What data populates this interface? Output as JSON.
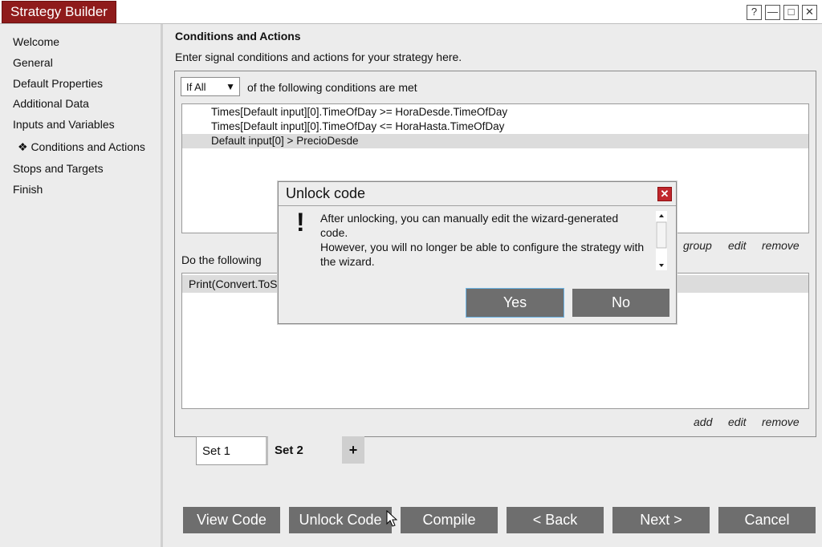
{
  "window": {
    "title": "Strategy Builder",
    "controls": {
      "help": "?",
      "minimize": "—",
      "maximize": "□",
      "close": "✕"
    }
  },
  "sidebar": {
    "items": [
      {
        "label": "Welcome"
      },
      {
        "label": "General"
      },
      {
        "label": "Default Properties"
      },
      {
        "label": "Additional Data"
      },
      {
        "label": "Inputs and Variables"
      },
      {
        "label": "❖ Conditions and Actions"
      },
      {
        "label": "Stops and Targets"
      },
      {
        "label": "Finish"
      }
    ],
    "active_index": 5
  },
  "main": {
    "heading": "Conditions and Actions",
    "subheading": "Enter signal conditions and actions for your strategy here.",
    "condition_mode": "If All",
    "condition_suffix": "of the following conditions are met",
    "conditions": [
      "Times[Default input][0].TimeOfDay >= HoraDesde.TimeOfDay",
      "Times[Default input][0].TimeOfDay <= HoraHasta.TimeOfDay",
      "Default input[0] > PrecioDesde"
    ],
    "condition_links": {
      "group": "group",
      "edit": "edit",
      "remove": "remove"
    },
    "do_label": "Do the following",
    "actions": [
      "Print(Convert.ToS"
    ],
    "action_links": {
      "add": "add",
      "edit": "edit",
      "remove": "remove"
    },
    "sets": [
      {
        "label": "Set 1"
      },
      {
        "label": "Set 2"
      }
    ],
    "add_set": "+"
  },
  "buttons": {
    "view_code": "View Code",
    "unlock_code": "Unlock Code",
    "compile": "Compile",
    "back": "< Back",
    "next": "Next >",
    "cancel": "Cancel"
  },
  "dialog": {
    "title": "Unlock code",
    "icon": "!",
    "message_line1": "After unlocking, you can manually edit the wizard-generated code.",
    "message_line2": "However, you will no longer be able to configure the strategy with the wizard.",
    "yes": "Yes",
    "no": "No",
    "close": "✕"
  },
  "colors": {
    "brand": "#8f1b1b",
    "button": "#6e6e6e",
    "close": "#c0272d",
    "focus": "#6db6e8"
  }
}
